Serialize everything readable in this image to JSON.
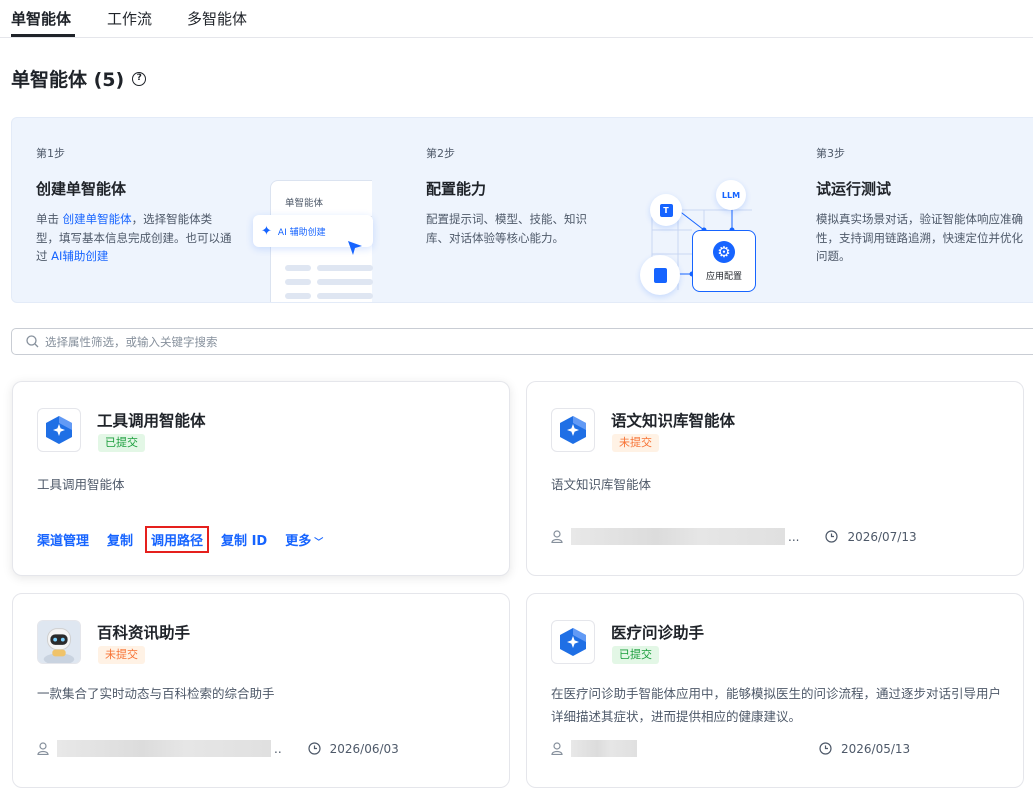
{
  "tabs": [
    {
      "label": "单智能体"
    },
    {
      "label": "工作流"
    },
    {
      "label": "多智能体"
    }
  ],
  "page": {
    "title": "单智能体 (5)"
  },
  "steps": [
    {
      "num": "第1步",
      "title": "创建单智能体",
      "desc_pre": "单击 ",
      "desc_link": "创建单智能体",
      "desc_mid": "，选择智能体类型，填写基本信息完成创建。也可以通过 ",
      "desc_link2": "AI辅助创建",
      "illustration": {
        "header": "单智能体",
        "ai_pill": "AI 辅助创建"
      }
    },
    {
      "num": "第2步",
      "title": "配置能力",
      "desc": "配置提示词、模型、技能、知识库、对话体验等核心能力。",
      "illustration": {
        "llm": "LLM",
        "box_label": "应用配置"
      }
    },
    {
      "num": "第3步",
      "title": "试运行测试",
      "desc": "模拟真实场景对话，验证智能体响应准确性，支持调用链路追溯，快速定位并优化问题。"
    }
  ],
  "search": {
    "placeholder": "选择属性筛选，或输入关键字搜索",
    "value": ""
  },
  "cards": [
    {
      "title": "工具调用智能体",
      "status": "已提交",
      "desc": "工具调用智能体",
      "actions": [
        "渠道管理",
        "复制",
        "调用路径",
        "复制 ID",
        "更多"
      ],
      "icon": "hexagon-sparkle-icon"
    },
    {
      "title": "语文知识库智能体",
      "status": "未提交",
      "desc": "语文知识库智能体",
      "owner_suffix": "...",
      "date": "2026/07/13",
      "icon": "hexagon-sparkle-icon"
    },
    {
      "title": "百科资讯助手",
      "status": "未提交",
      "desc": "一款集合了实时动态与百科检索的综合助手",
      "owner_suffix": "..",
      "date": "2026/06/03",
      "icon": "robot-avatar-icon"
    },
    {
      "title": "医疗问诊助手",
      "status": "已提交",
      "desc": "在医疗问诊助手智能体应用中，能够模拟医生的问诊流程，通过逐步对话引导用户详细描述其症状，进而提供相应的健康建议。",
      "date": "2026/05/13",
      "icon": "hexagon-sparkle-icon"
    }
  ],
  "colors": {
    "accent": "#1664ff",
    "submitted": "#1a9e3c",
    "unsubmitted": "#f77234",
    "highlight_box": "#e5201d"
  }
}
